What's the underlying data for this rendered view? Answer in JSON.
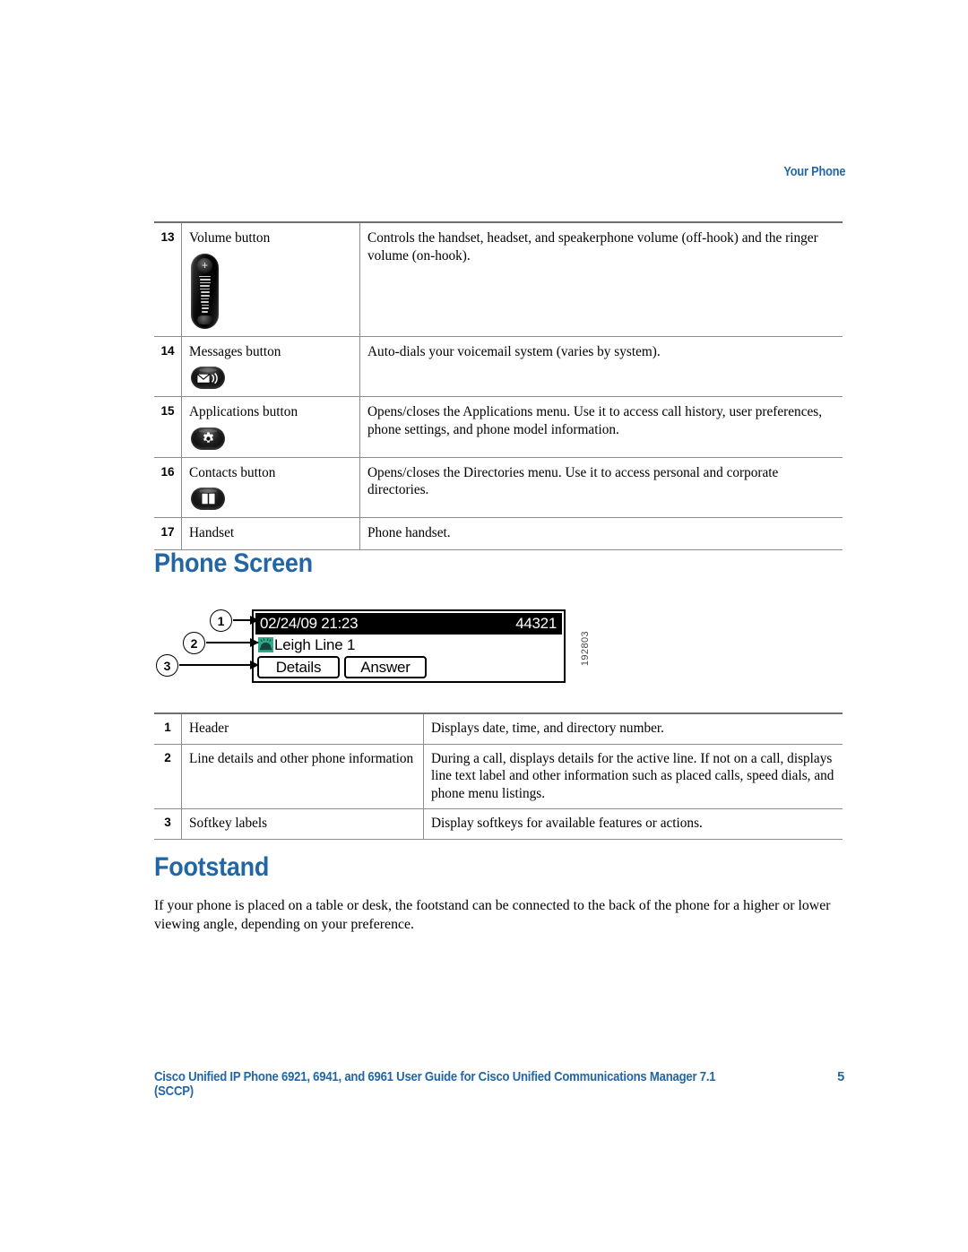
{
  "running_head": "Your Phone",
  "colors": {
    "heading_blue": "#2266a4",
    "line_icon_green": "#2bab8c",
    "rule_gray": "#8d8d8d"
  },
  "buttons_table": {
    "rows": [
      {
        "num": "13",
        "term": "Volume button",
        "icon": "volume-rocker-icon",
        "description": "Controls the handset, headset, and speakerphone volume (off-hook) and the ringer volume (on-hook)."
      },
      {
        "num": "14",
        "term": "Messages button",
        "icon": "envelope-messages-icon",
        "description": "Auto-dials your voicemail system (varies by system)."
      },
      {
        "num": "15",
        "term": "Applications button",
        "icon": "gear-applications-icon",
        "description": "Opens/closes the Applications menu. Use it to access call history, user preferences, phone settings, and phone model information."
      },
      {
        "num": "16",
        "term": "Contacts button",
        "icon": "book-contacts-icon",
        "description": "Opens/closes the Directories menu. Use it to access personal and corporate directories."
      },
      {
        "num": "17",
        "term": "Handset",
        "icon": "",
        "description": "Phone handset."
      }
    ]
  },
  "phone_screen_section": {
    "heading": "Phone Screen",
    "figure": {
      "callouts": [
        "1",
        "2",
        "3"
      ],
      "header": {
        "datetime": "02/24/09 21:23",
        "directory_number": "44321"
      },
      "line": {
        "icon": "ringing-phone-icon",
        "label": "Leigh Line 1"
      },
      "softkeys": [
        "Details",
        "Answer"
      ],
      "figure_id": "192803"
    },
    "table": {
      "rows": [
        {
          "num": "1",
          "term": "Header",
          "description": "Displays date, time, and directory number."
        },
        {
          "num": "2",
          "term": "Line details and other phone information",
          "description": "During a call, displays details for the active line. If not on a call, displays line text label and other information such as placed calls, speed dials, and phone menu listings."
        },
        {
          "num": "3",
          "term": "Softkey labels",
          "description": "Display softkeys for available features or actions."
        }
      ]
    }
  },
  "footstand_section": {
    "heading": "Footstand",
    "paragraph": "If your phone is placed on a table or desk, the footstand can be connected to the back of the phone for a higher or lower viewing angle, depending on your preference."
  },
  "footer": {
    "title": "Cisco Unified IP Phone 6921, 6941, and 6961 User Guide for Cisco Unified Communications Manager 7.1 (SCCP)",
    "page_number": "5"
  }
}
